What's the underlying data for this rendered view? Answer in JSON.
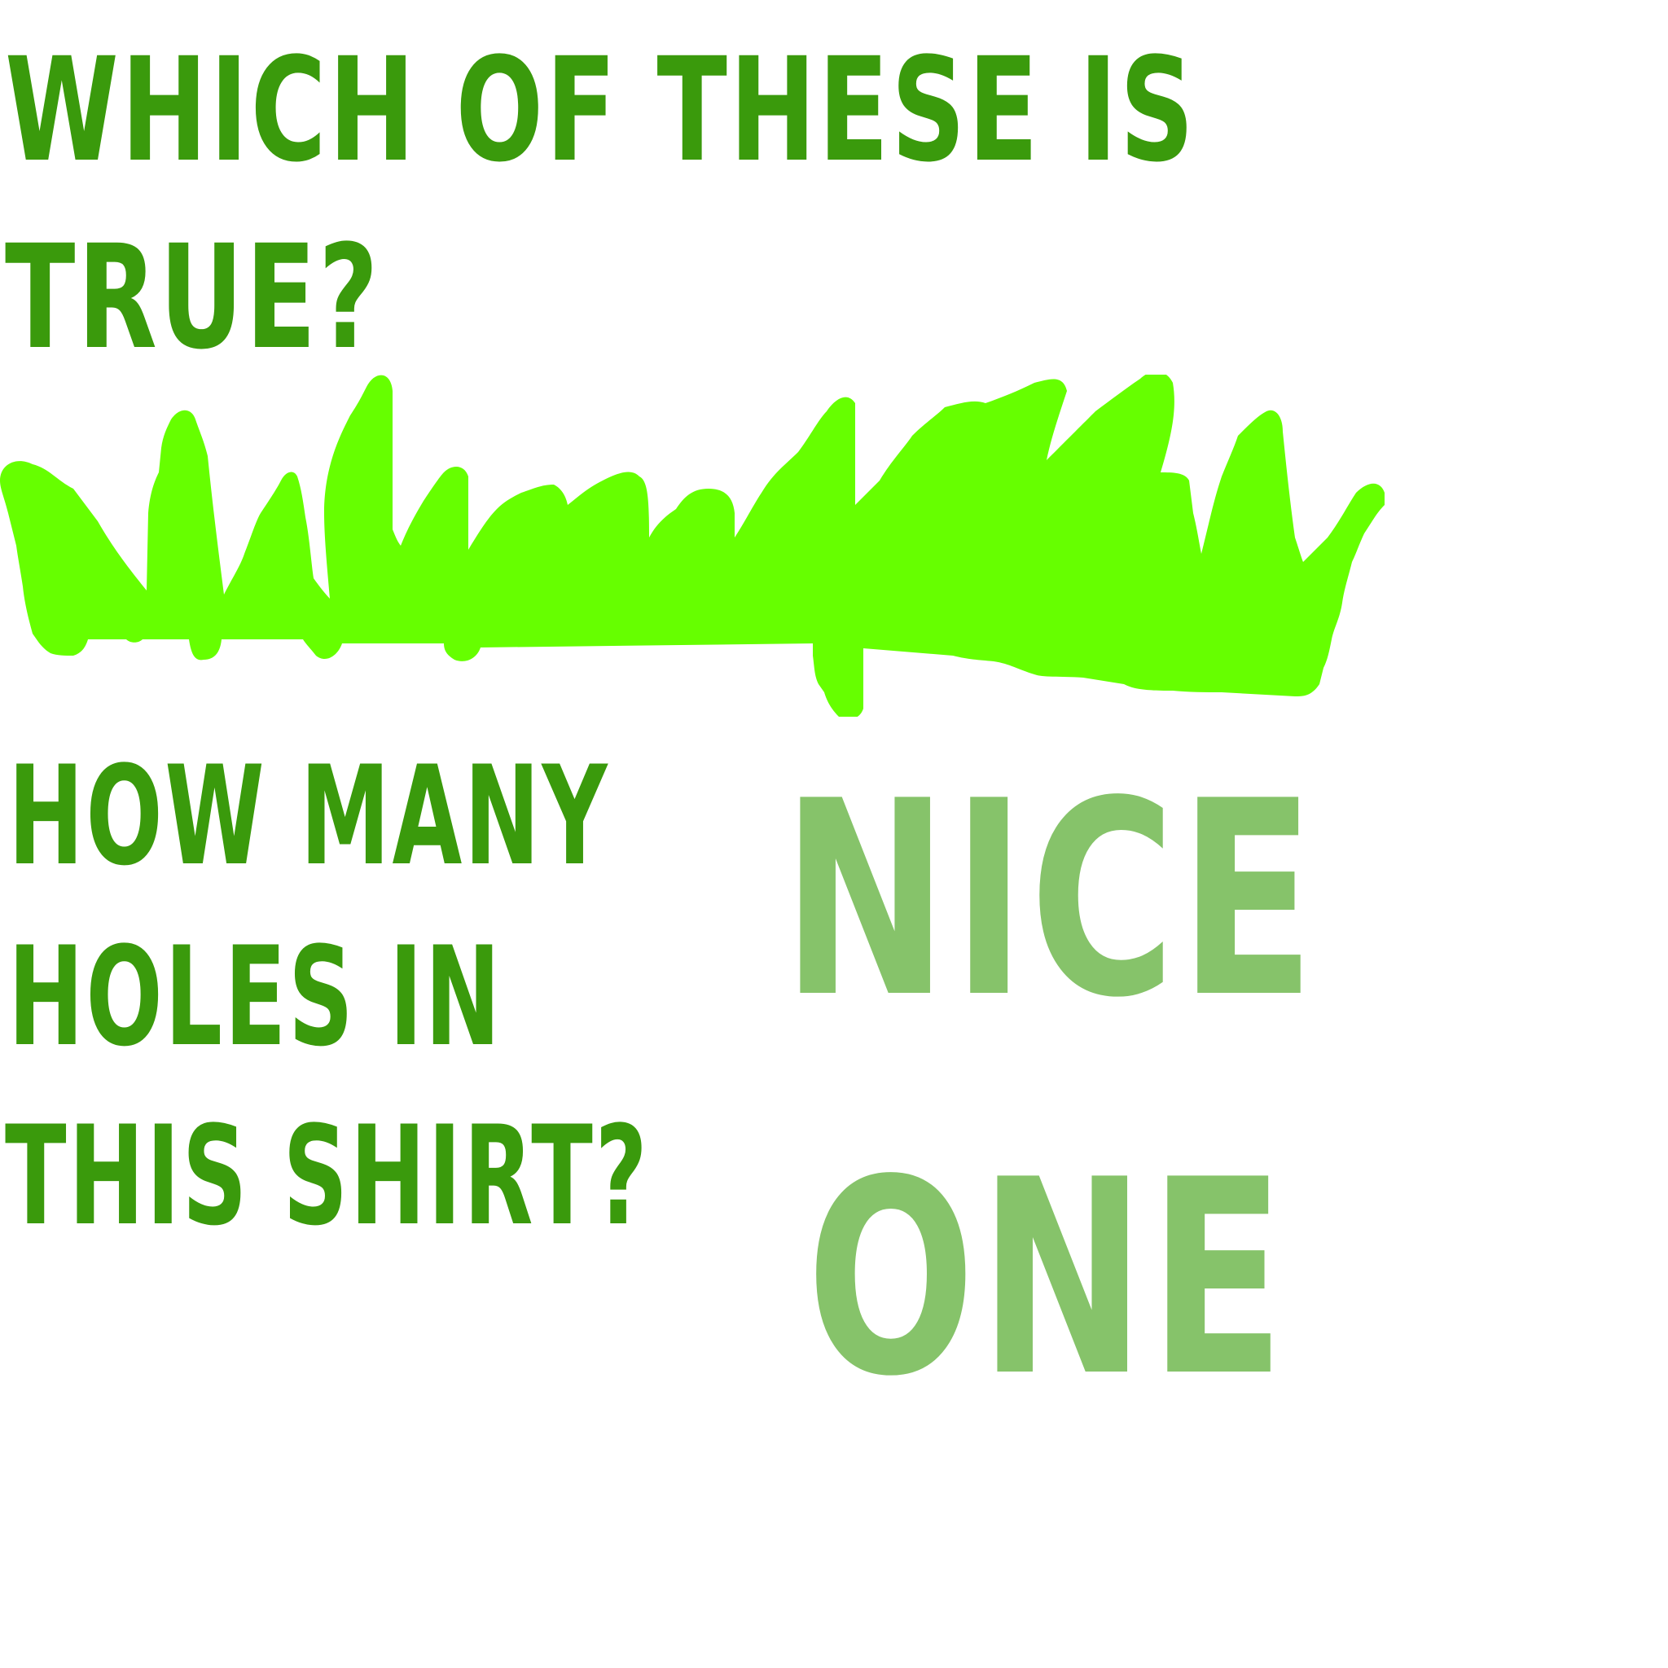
{
  "question_one": {
    "line1": "WHICH OF THESE IS",
    "line2": "TRUE?"
  },
  "question_two": {
    "line1": "HOW MANY",
    "line2": "HOLES IN",
    "line3": "THIS SHIRT?"
  },
  "answer": {
    "line1": "NICE",
    "line2": "ONE"
  },
  "colors": {
    "question_text": "#3a9a0c",
    "answer_text": "#86c36a",
    "grass": "#66ff00"
  }
}
